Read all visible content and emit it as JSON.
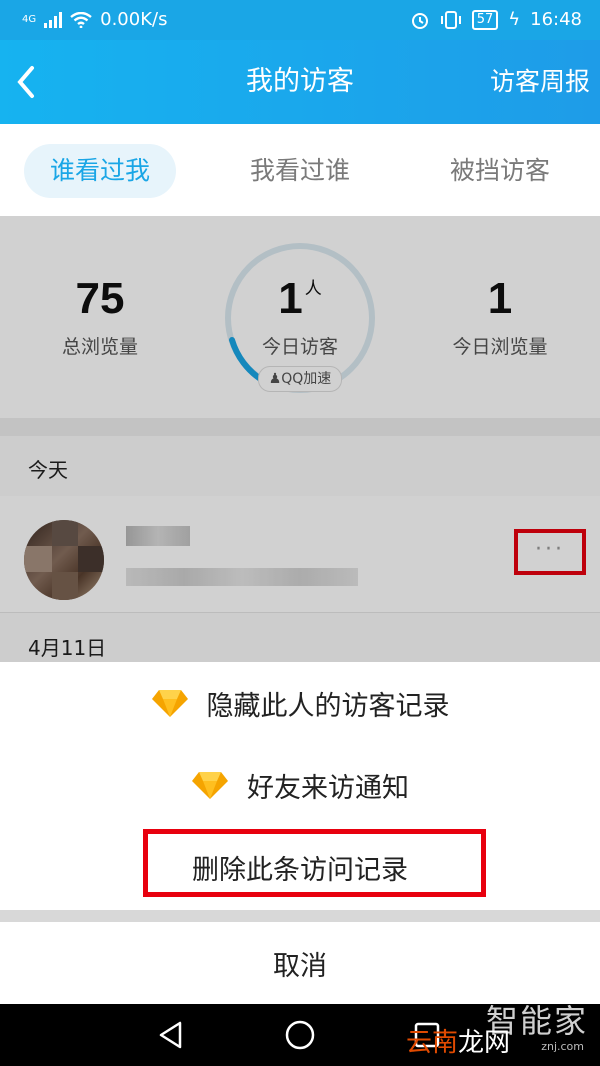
{
  "status_bar": {
    "network": "4G",
    "speed": "0.00K/s",
    "battery": "57",
    "time": "16:48"
  },
  "header": {
    "title": "我的访客",
    "right_action": "访客周报"
  },
  "tabs": [
    {
      "label": "谁看过我",
      "active": true
    },
    {
      "label": "我看过谁",
      "active": false
    },
    {
      "label": "被挡访客",
      "active": false
    }
  ],
  "stats": {
    "total_views": "75",
    "total_views_label": "总浏览量",
    "today_visitors": "1",
    "today_visitors_unit": "人",
    "today_visitors_label": "今日访客",
    "today_views": "1",
    "today_views_label": "今日浏览量",
    "qq_badge": "QQ加速"
  },
  "sections": {
    "today": "今天",
    "earlier": "4月11日"
  },
  "more_button": "···",
  "action_sheet": {
    "items": [
      {
        "label": "隐藏此人的访客记录",
        "icon": "diamond-icon"
      },
      {
        "label": "好友来访通知",
        "icon": "diamond-icon"
      },
      {
        "label": "删除此条访问记录"
      }
    ],
    "cancel": "取消"
  },
  "watermark": {
    "line1": "智能家",
    "line2_a": "云南",
    "line2_b": "龙网",
    "line3": "znj.com"
  },
  "colors": {
    "accent": "#1aa6e6",
    "highlight": "#e8000e",
    "diamond": "#f5a400"
  }
}
